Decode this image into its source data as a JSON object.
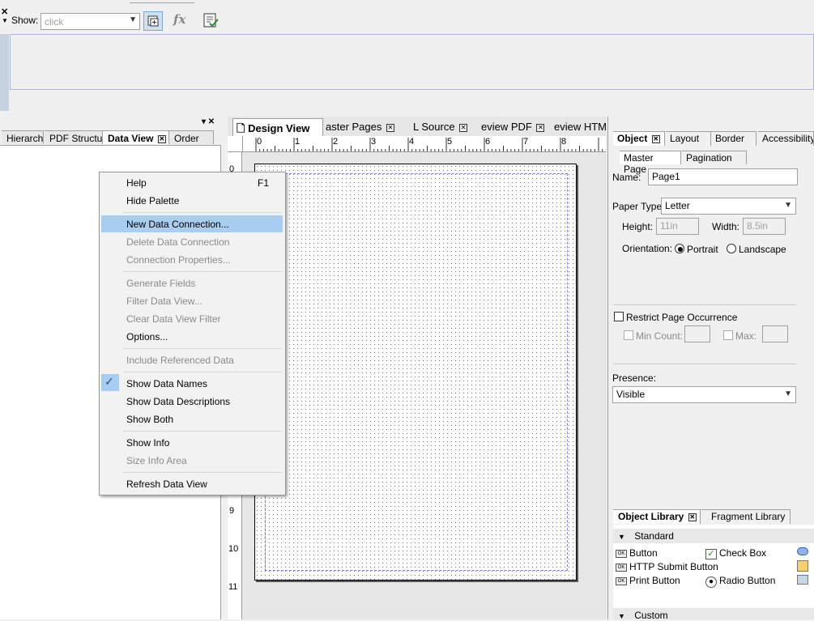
{
  "toolbar": {
    "show_label": "Show:",
    "show_value": "click"
  },
  "left_palette": {
    "tabs": [
      "Hierarch",
      "PDF Structur",
      "Data View",
      "Order"
    ]
  },
  "center": {
    "tabs": [
      "Design View",
      "aster Pages",
      "L Source",
      "eview PDF",
      "eview HTM"
    ],
    "ruler_h": [
      "0",
      "1",
      "2",
      "3",
      "4",
      "5",
      "6",
      "7",
      "8"
    ],
    "ruler_v": [
      "0",
      "9",
      "10",
      "11"
    ]
  },
  "context_menu": {
    "items": [
      {
        "label": "Help",
        "shortcut": "F1"
      },
      {
        "label": "Hide Palette"
      },
      {
        "label": "New Data Connection..."
      },
      {
        "label": "Delete Data Connection"
      },
      {
        "label": "Connection Properties..."
      },
      {
        "label": "Generate Fields"
      },
      {
        "label": "Filter Data View..."
      },
      {
        "label": "Clear Data View Filter"
      },
      {
        "label": "Options..."
      },
      {
        "label": "Include Referenced Data"
      },
      {
        "label": "Show Data Names"
      },
      {
        "label": "Show Data Descriptions"
      },
      {
        "label": "Show Both"
      },
      {
        "label": "Show Info"
      },
      {
        "label": "Size Info Area"
      },
      {
        "label": "Refresh Data View"
      }
    ]
  },
  "object_palette": {
    "tabs": [
      "Object",
      "Layout",
      "Border",
      "Accessibility"
    ],
    "subtabs": [
      "Master Page",
      "Pagination"
    ],
    "name_label": "Name:",
    "name_value": "Page1",
    "paper_type_label": "Paper Type:",
    "paper_type_value": "Letter",
    "height_label": "Height:",
    "height_value": "11in",
    "width_label": "Width:",
    "width_value": "8.5in",
    "orientation_label": "Orientation:",
    "portrait": "Portrait",
    "landscape": "Landscape",
    "restrict_label": "Restrict Page Occurrence",
    "min_count_label": "Min Count:",
    "max_label": "Max:",
    "presence_label": "Presence:",
    "presence_value": "Visible"
  },
  "library": {
    "tabs": [
      "Object Library",
      "Fragment Library"
    ],
    "standard_label": "Standard",
    "custom_label": "Custom",
    "items": [
      "Button",
      "HTTP Submit Button",
      "Print Button",
      "Check Box",
      "Radio Button"
    ]
  }
}
